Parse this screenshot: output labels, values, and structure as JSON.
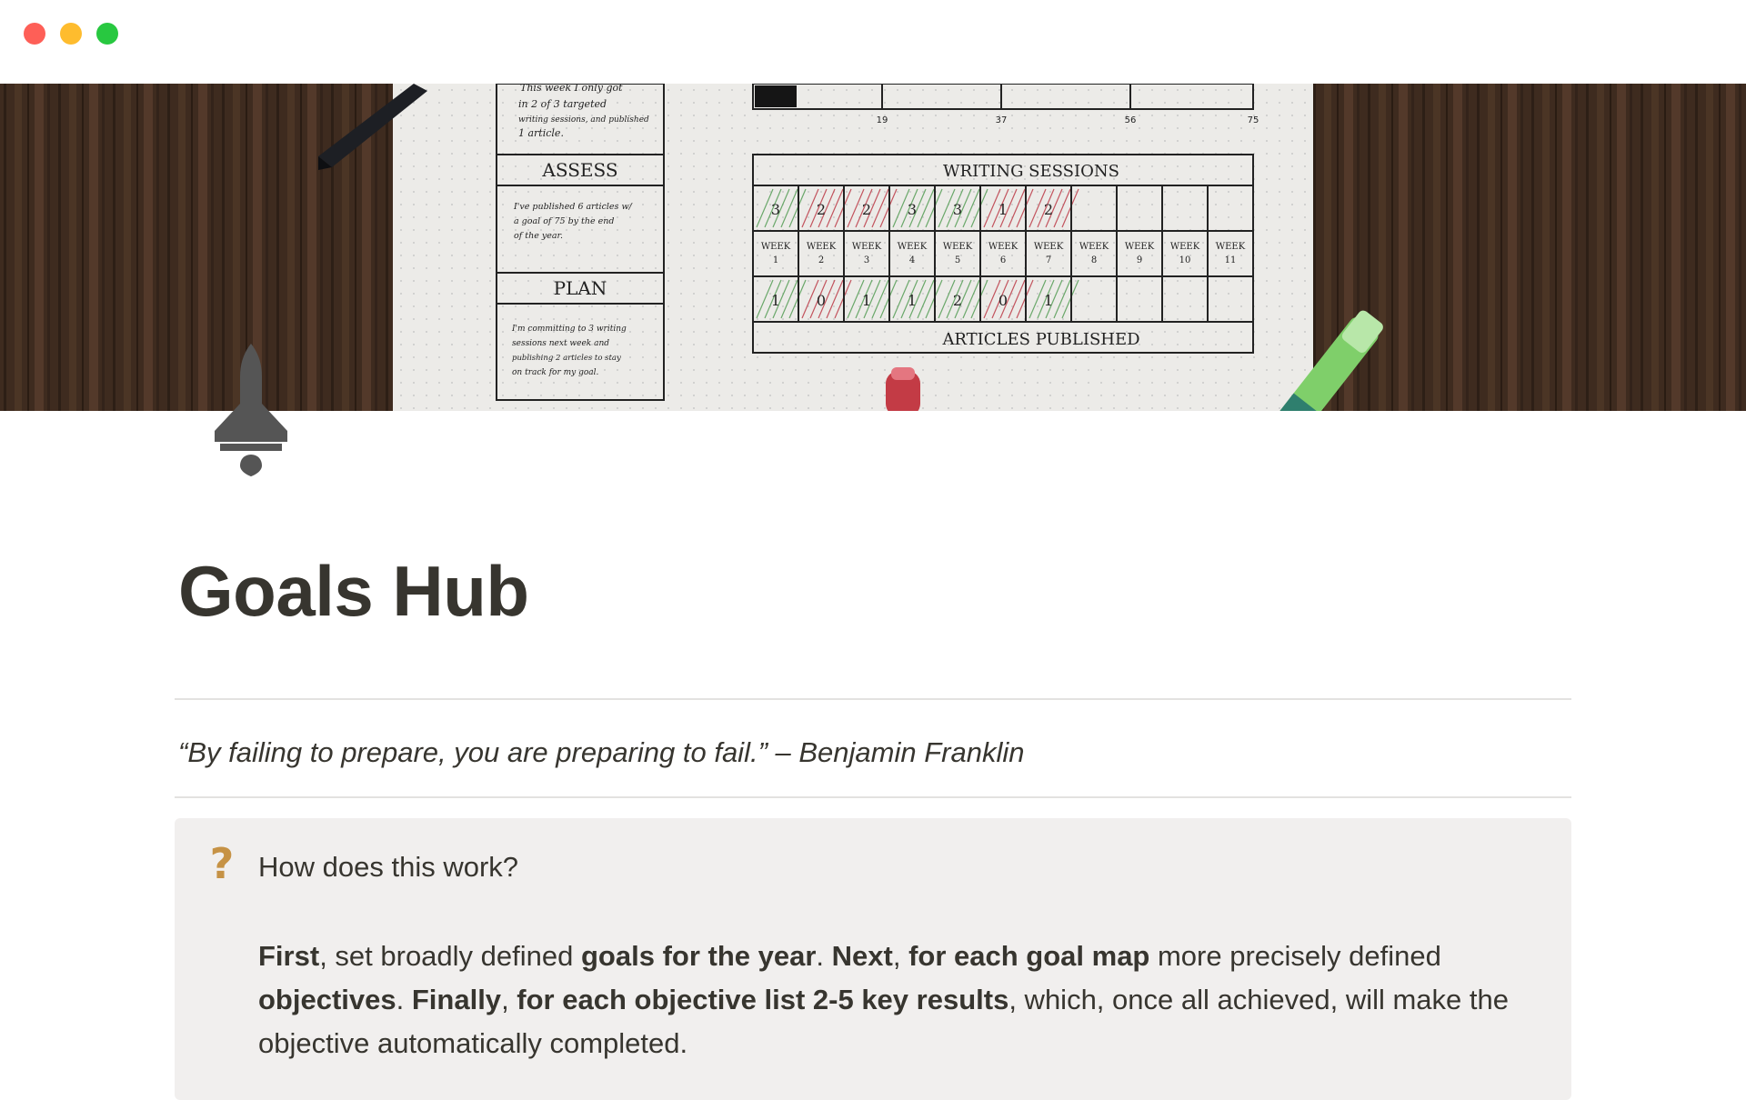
{
  "window": {
    "controls": [
      "close",
      "minimize",
      "maximize"
    ]
  },
  "cover": {
    "description_icons": [
      "pen-icon",
      "marker-icon",
      "highlighter-icon"
    ],
    "notebook": {
      "left_column": {
        "intro_lines": [
          "This week I only got",
          "in 2 of 3 targeted",
          "writing sessions, and published",
          "1 article."
        ],
        "assess_heading": "ASSESS",
        "assess_lines": [
          "I've published 6 articles w/",
          "a goal of 75 by the end",
          "of the year."
        ],
        "plan_heading": "PLAN",
        "plan_lines": [
          "I'm committing to 3 writing",
          "sessions next week and",
          "publishing 2 articles to stay",
          "on track for my goal."
        ]
      },
      "progress_ticks": [
        "19",
        "37",
        "56",
        "75"
      ],
      "writing_sessions_title": "WRITING SESSIONS",
      "sessions": [
        "3",
        "2",
        "2",
        "3",
        "3",
        "1",
        "2",
        "",
        "",
        "",
        ""
      ],
      "weeks": [
        "WEEK 1",
        "WEEK 2",
        "WEEK 3",
        "WEEK 4",
        "WEEK 5",
        "WEEK 6",
        "WEEK 7",
        "WEEK 8",
        "WEEK 9",
        "WEEK 10",
        "WEEK 11"
      ],
      "articles": [
        "1",
        "0",
        "1",
        "1",
        "2",
        "0",
        "1",
        "",
        "",
        "",
        ""
      ],
      "articles_title": "ARTICLES PUBLISHED"
    }
  },
  "page_icon": "rocket-icon",
  "title": "Goals Hub",
  "quote": "“By failing to prepare, you are preparing to fail.” – Benjamin Franklin",
  "callout": {
    "icon": "question-mark-icon",
    "icon_glyph": "?",
    "icon_color": "#c69245",
    "background": "#f1efee",
    "heading": "How does this work?",
    "body": {
      "s1": "First",
      "s2": ", set broadly defined ",
      "s3": "goals for the year",
      "s4": ". ",
      "s5": "Next",
      "s6": ", ",
      "s7": "for each goal map",
      "s8": " more precisely defined ",
      "s9": "objectives",
      "s10": ". ",
      "s11": "Finally",
      "s12": ", ",
      "s13": "for each objective list 2-5 key results",
      "s14": ", which, once all achieved, will make the objective automatically completed."
    }
  }
}
